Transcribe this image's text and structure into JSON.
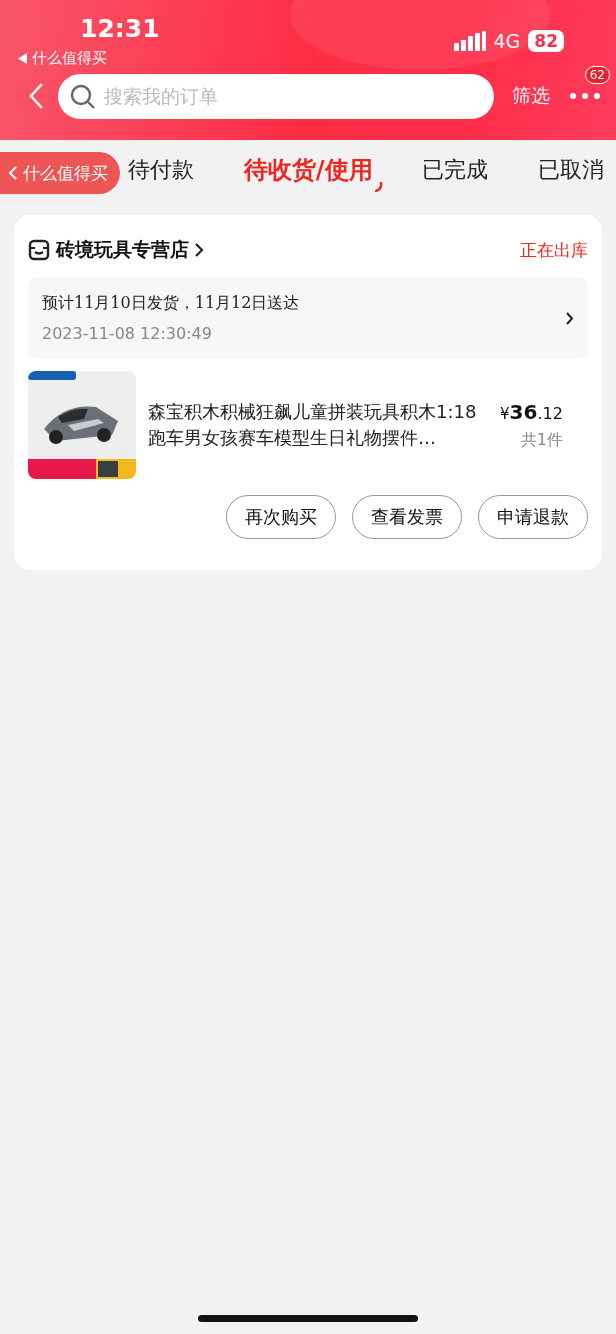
{
  "status_bar": {
    "time": "12:31",
    "back_app": "什么值得买",
    "network": "4G",
    "battery": "82"
  },
  "header": {
    "search": {
      "placeholder": "搜索我的订单"
    },
    "filter": "筛选",
    "more_badge": "62"
  },
  "tabs": [
    {
      "label": "待付款",
      "selected": false
    },
    {
      "label": "待收货/使用",
      "selected": true
    },
    {
      "label": "已完成",
      "selected": false
    },
    {
      "label": "已取消",
      "selected": false
    }
  ],
  "floating_back": {
    "label": "什么值得买"
  },
  "order": {
    "store": "砖境玩具专营店",
    "status": "正在出库",
    "shipping_note": "预计11月10日发货，11月12日送达",
    "order_time": "2023-11-08 12:30:49",
    "product": {
      "kind": "picture",
      "title": "森宝积木积械狂飙儿童拼装玩具积木1:18跑车男女孩赛车模型生日礼物摆件…",
      "price_symbol": "¥",
      "price_integer": "36",
      "price_decimal": ".12",
      "quantity": "共1件"
    },
    "actions": [
      "再次购买",
      "查看发票",
      "申请退款"
    ]
  }
}
